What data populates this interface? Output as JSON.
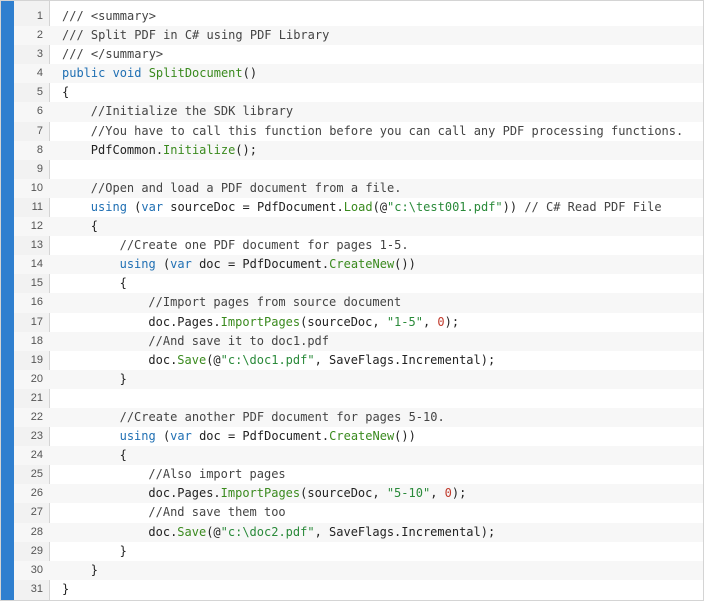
{
  "editor": {
    "accent_color": "#2f7fcf",
    "lines": [
      {
        "number": "1",
        "indent": 0,
        "tokens": [
          {
            "t": "/// <summary>",
            "k": "comment"
          }
        ]
      },
      {
        "number": "2",
        "indent": 0,
        "tokens": [
          {
            "t": "/// Split PDF in C# using PDF Library",
            "k": "comment"
          }
        ]
      },
      {
        "number": "3",
        "indent": 0,
        "tokens": [
          {
            "t": "/// </summary>",
            "k": "comment"
          }
        ]
      },
      {
        "number": "4",
        "indent": 0,
        "tokens": [
          {
            "t": "public void ",
            "k": "kw"
          },
          {
            "t": "SplitDocument",
            "k": "method"
          },
          {
            "t": "()",
            "k": "plain"
          }
        ]
      },
      {
        "number": "5",
        "indent": 0,
        "tokens": [
          {
            "t": "{",
            "k": "plain"
          }
        ]
      },
      {
        "number": "6",
        "indent": 1,
        "tokens": [
          {
            "t": "//Initialize the SDK library",
            "k": "comment"
          }
        ]
      },
      {
        "number": "7",
        "indent": 1,
        "tokens": [
          {
            "t": "//You have to call this function before you can call any PDF processing functions.",
            "k": "comment"
          }
        ]
      },
      {
        "number": "8",
        "indent": 1,
        "tokens": [
          {
            "t": "PdfCommon.",
            "k": "plain"
          },
          {
            "t": "Initialize",
            "k": "method"
          },
          {
            "t": "();",
            "k": "plain"
          }
        ]
      },
      {
        "number": "9",
        "indent": 0,
        "tokens": []
      },
      {
        "number": "10",
        "indent": 1,
        "tokens": [
          {
            "t": "//Open and load a PDF document from a file.",
            "k": "comment"
          }
        ]
      },
      {
        "number": "11",
        "indent": 1,
        "tokens": [
          {
            "t": "using",
            "k": "kw"
          },
          {
            "t": " (",
            "k": "plain"
          },
          {
            "t": "var",
            "k": "kw"
          },
          {
            "t": " sourceDoc = PdfDocument.",
            "k": "plain"
          },
          {
            "t": "Load",
            "k": "method"
          },
          {
            "t": "(@",
            "k": "plain"
          },
          {
            "t": "\"c:\\test001.pdf\"",
            "k": "str"
          },
          {
            "t": ")) ",
            "k": "plain"
          },
          {
            "t": "// C# Read PDF File",
            "k": "comment"
          }
        ]
      },
      {
        "number": "12",
        "indent": 1,
        "tokens": [
          {
            "t": "{",
            "k": "plain"
          }
        ]
      },
      {
        "number": "13",
        "indent": 2,
        "tokens": [
          {
            "t": "//Create one PDF document for pages 1-5.",
            "k": "comment"
          }
        ]
      },
      {
        "number": "14",
        "indent": 2,
        "tokens": [
          {
            "t": "using",
            "k": "kw"
          },
          {
            "t": " (",
            "k": "plain"
          },
          {
            "t": "var",
            "k": "kw"
          },
          {
            "t": " doc = PdfDocument.",
            "k": "plain"
          },
          {
            "t": "CreateNew",
            "k": "method"
          },
          {
            "t": "())",
            "k": "plain"
          }
        ]
      },
      {
        "number": "15",
        "indent": 2,
        "tokens": [
          {
            "t": "{",
            "k": "plain"
          }
        ]
      },
      {
        "number": "16",
        "indent": 3,
        "tokens": [
          {
            "t": "//Import pages from source document",
            "k": "comment"
          }
        ]
      },
      {
        "number": "17",
        "indent": 3,
        "tokens": [
          {
            "t": "doc.Pages.",
            "k": "plain"
          },
          {
            "t": "ImportPages",
            "k": "method"
          },
          {
            "t": "(sourceDoc, ",
            "k": "plain"
          },
          {
            "t": "\"1-5\"",
            "k": "str"
          },
          {
            "t": ", ",
            "k": "plain"
          },
          {
            "t": "0",
            "k": "num"
          },
          {
            "t": ");",
            "k": "plain"
          }
        ]
      },
      {
        "number": "18",
        "indent": 3,
        "tokens": [
          {
            "t": "//And save it to doc1.pdf",
            "k": "comment"
          }
        ]
      },
      {
        "number": "19",
        "indent": 3,
        "tokens": [
          {
            "t": "doc.",
            "k": "plain"
          },
          {
            "t": "Save",
            "k": "method"
          },
          {
            "t": "(@",
            "k": "plain"
          },
          {
            "t": "\"c:\\doc1.pdf\"",
            "k": "str"
          },
          {
            "t": ", SaveFlags.Incremental);",
            "k": "plain"
          }
        ]
      },
      {
        "number": "20",
        "indent": 2,
        "tokens": [
          {
            "t": "}",
            "k": "plain"
          }
        ]
      },
      {
        "number": "21",
        "indent": 0,
        "tokens": []
      },
      {
        "number": "22",
        "indent": 2,
        "tokens": [
          {
            "t": "//Create another PDF document for pages 5-10.",
            "k": "comment"
          }
        ]
      },
      {
        "number": "23",
        "indent": 2,
        "tokens": [
          {
            "t": "using",
            "k": "kw"
          },
          {
            "t": " (",
            "k": "plain"
          },
          {
            "t": "var",
            "k": "kw"
          },
          {
            "t": " doc = PdfDocument.",
            "k": "plain"
          },
          {
            "t": "CreateNew",
            "k": "method"
          },
          {
            "t": "())",
            "k": "plain"
          }
        ]
      },
      {
        "number": "24",
        "indent": 2,
        "tokens": [
          {
            "t": "{",
            "k": "plain"
          }
        ]
      },
      {
        "number": "25",
        "indent": 3,
        "tokens": [
          {
            "t": "//Also import pages",
            "k": "comment"
          }
        ]
      },
      {
        "number": "26",
        "indent": 3,
        "tokens": [
          {
            "t": "doc.Pages.",
            "k": "plain"
          },
          {
            "t": "ImportPages",
            "k": "method"
          },
          {
            "t": "(sourceDoc, ",
            "k": "plain"
          },
          {
            "t": "\"5-10\"",
            "k": "str"
          },
          {
            "t": ", ",
            "k": "plain"
          },
          {
            "t": "0",
            "k": "num"
          },
          {
            "t": ");",
            "k": "plain"
          }
        ]
      },
      {
        "number": "27",
        "indent": 3,
        "tokens": [
          {
            "t": "//And save them too",
            "k": "comment"
          }
        ]
      },
      {
        "number": "28",
        "indent": 3,
        "tokens": [
          {
            "t": "doc.",
            "k": "plain"
          },
          {
            "t": "Save",
            "k": "method"
          },
          {
            "t": "(@",
            "k": "plain"
          },
          {
            "t": "\"c:\\doc2.pdf\"",
            "k": "str"
          },
          {
            "t": ", SaveFlags.Incremental);",
            "k": "plain"
          }
        ]
      },
      {
        "number": "29",
        "indent": 2,
        "tokens": [
          {
            "t": "}",
            "k": "plain"
          }
        ]
      },
      {
        "number": "30",
        "indent": 1,
        "tokens": [
          {
            "t": "}",
            "k": "plain"
          }
        ]
      },
      {
        "number": "31",
        "indent": 0,
        "tokens": [
          {
            "t": "}",
            "k": "plain"
          }
        ]
      }
    ]
  }
}
